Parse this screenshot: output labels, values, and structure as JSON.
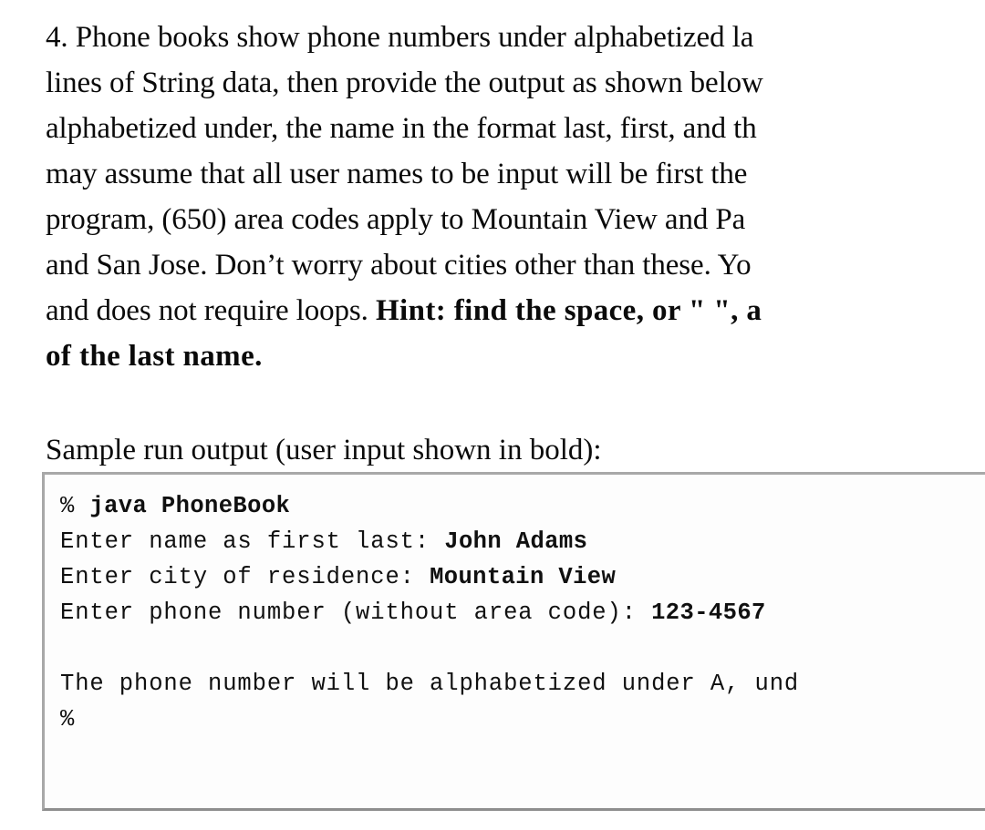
{
  "document": {
    "problem_number": "4.",
    "problem_lines": [
      {
        "segments": [
          {
            "text": "4. Phone books show phone numbers under alphabetized la",
            "bold": false
          }
        ]
      },
      {
        "segments": [
          {
            "text": "lines of String data, then provide the output as shown below",
            "bold": false
          }
        ]
      },
      {
        "segments": [
          {
            "text": "alphabetized under, the name in the format last, first, and th",
            "bold": false
          }
        ]
      },
      {
        "segments": [
          {
            "text": "may assume that all user names to be input will be first the",
            "bold": false
          }
        ]
      },
      {
        "segments": [
          {
            "text": "program, (650) area codes apply to Mountain View and Pa",
            "bold": false
          }
        ]
      },
      {
        "segments": [
          {
            "text": "and San Jose. Don’t worry about cities other than these. Yo",
            "bold": false
          }
        ]
      },
      {
        "segments": [
          {
            "text": "and does not require loops. ",
            "bold": false
          },
          {
            "text": "Hint: find the space, or \" \", a",
            "bold": true
          }
        ]
      },
      {
        "segments": [
          {
            "text": "of the last name.",
            "bold": true
          }
        ]
      }
    ],
    "sample_heading": "Sample run output (user input shown in bold):",
    "terminal": {
      "lines": [
        {
          "id": "command-line",
          "segments": [
            {
              "text": "% ",
              "bold": false
            },
            {
              "text": "java PhoneBook",
              "bold": true
            }
          ]
        },
        {
          "id": "prompt-name",
          "segments": [
            {
              "text": "Enter name as first last: ",
              "bold": false
            },
            {
              "text": "John Adams",
              "bold": true
            }
          ]
        },
        {
          "id": "prompt-city",
          "segments": [
            {
              "text": "Enter city of residence: ",
              "bold": false
            },
            {
              "text": "Mountain View",
              "bold": true
            }
          ]
        },
        {
          "id": "prompt-phone",
          "segments": [
            {
              "text": "Enter phone number (without area code): ",
              "bold": false
            },
            {
              "text": "123-4567",
              "bold": true
            }
          ]
        },
        {
          "id": "blank-line",
          "segments": [
            {
              "text": " ",
              "bold": false
            }
          ]
        },
        {
          "id": "result-line",
          "segments": [
            {
              "text": "The phone number will be alphabetized under A, und",
              "bold": false
            }
          ]
        },
        {
          "id": "final-prompt",
          "segments": [
            {
              "text": "%",
              "bold": false
            }
          ]
        }
      ]
    }
  },
  "colors": {
    "page_background": "#ffffff",
    "text": "#0a0a0a",
    "terminal_border": "#9e9e9e",
    "terminal_background": "#fdfdfd"
  }
}
